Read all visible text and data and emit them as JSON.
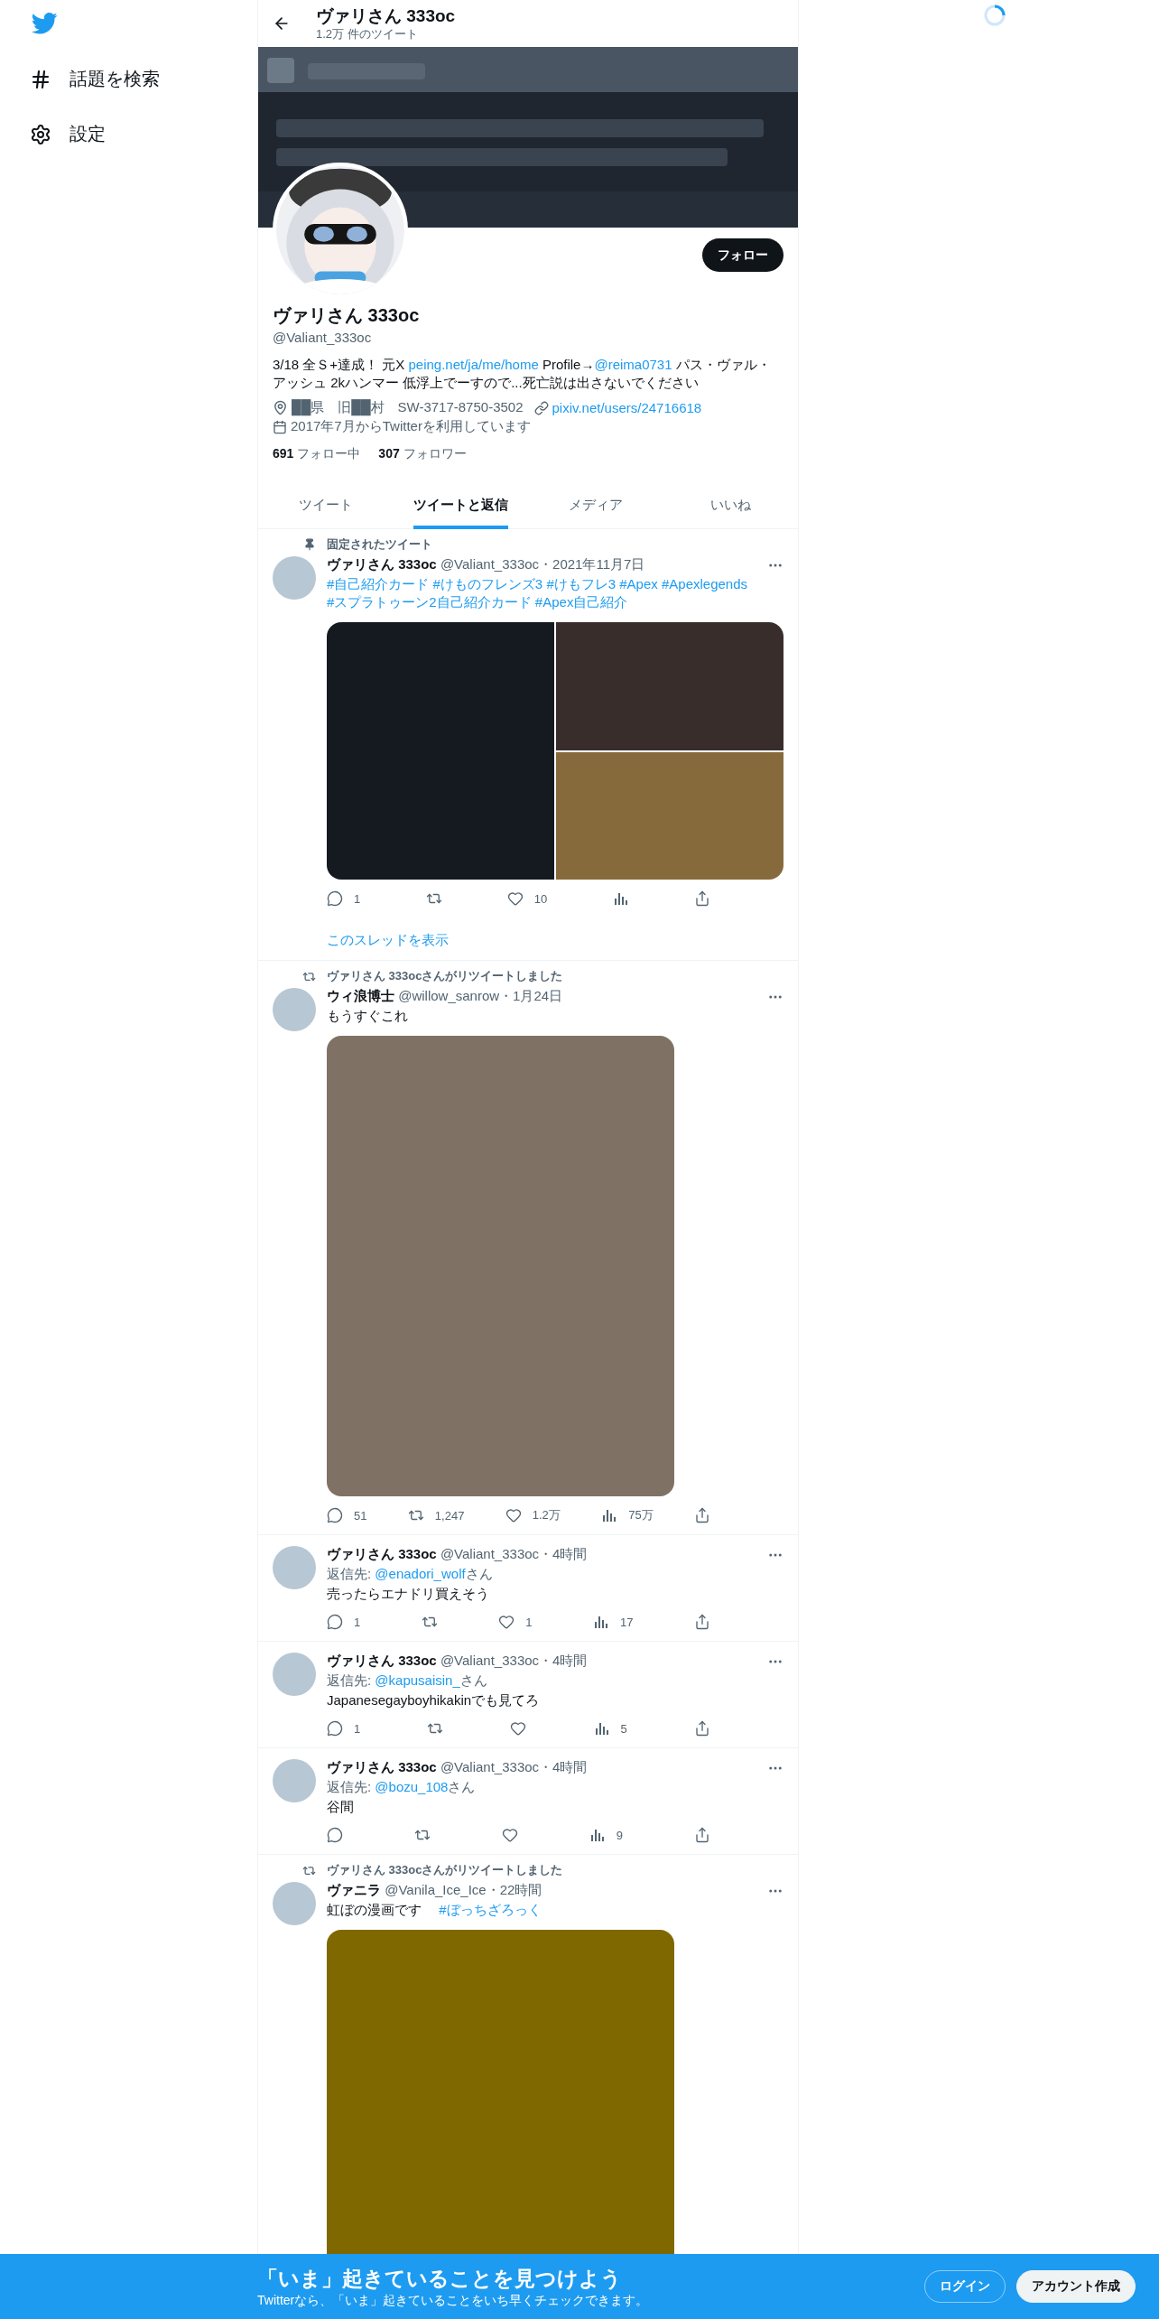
{
  "sidebar": {
    "items": [
      {
        "kind": "explore",
        "label": "話題を検索"
      },
      {
        "kind": "settings",
        "label": "設定"
      }
    ]
  },
  "header": {
    "title": "ヴァリさん 333oc",
    "subtitle": "1.2万 件のツイート"
  },
  "profile": {
    "follow_button": "フォロー",
    "name": "ヴァリさん 333oc",
    "handle": "@Valiant_333oc",
    "bio": [
      {
        "text": "3/18 全Ｓ+達成！ 元X "
      },
      {
        "text": "peing.net/ja/me/home",
        "link": true
      },
      {
        "text": " Profile→"
      },
      {
        "text": "@reima0731",
        "link": true
      },
      {
        "text": " パス・ヴァル・アッシュ 2kハンマー 低浮上でーすので...死亡説は出さないでください"
      }
    ],
    "location": "██県　旧██村　SW-3717-8750-3502",
    "website": "pixiv.net/users/24716618",
    "joined": "2017年7月からTwitterを利用しています",
    "following_count": "691",
    "following_label": "フォロー中",
    "followers_count": "307",
    "followers_label": "フォロワー"
  },
  "tabs": [
    {
      "label": "ツイート",
      "selected": false
    },
    {
      "label": "ツイートと返信",
      "selected": true
    },
    {
      "label": "メディア",
      "selected": false
    },
    {
      "label": "いいね",
      "selected": false
    }
  ],
  "tweets": [
    {
      "context": {
        "kind": "pinned",
        "text": "固定されたツイート"
      },
      "name": "ヴァリさん 333oc",
      "handle": "@Valiant_333oc",
      "time": "・2021年11月7日",
      "text": [
        {
          "text": "#自己紹介カード",
          "link": true
        },
        {
          "text": "#けものフレンズ3",
          "link": true
        },
        {
          "text": "#けもフレ3",
          "link": true
        },
        {
          "text": "#Apex",
          "link": true
        },
        {
          "text": "#Apexlegends",
          "link": true
        },
        {
          "text": "#スプラトゥーン2自己紹介カード",
          "link": true
        },
        {
          "text": "#Apex自己紹介",
          "link": true
        }
      ],
      "media": {
        "kind": "grid",
        "tiles": [
          {
            "color": "#141a20"
          },
          {
            "color": "#382d2b"
          },
          {
            "color": "#876a3c"
          }
        ]
      },
      "actions": [
        {
          "kind": "reply",
          "count": "1"
        },
        {
          "kind": "retweet"
        },
        {
          "kind": "like",
          "count": "10"
        },
        {
          "kind": "views"
        },
        {
          "kind": "share"
        }
      ],
      "show_thread": "このスレッドを表示"
    },
    {
      "context": {
        "kind": "retweet",
        "text": "ヴァリさん 333ocさんがリツイートしました"
      },
      "name": "ウィ浪博士",
      "handle": "@willow_sanrow",
      "time": "・1月24日",
      "text": [
        {
          "text": "もうすぐこれ"
        }
      ],
      "media": {
        "kind": "single",
        "tiles": [
          {
            "color": "#7f7265"
          }
        ]
      },
      "actions": [
        {
          "kind": "reply",
          "count": "51"
        },
        {
          "kind": "retweet",
          "count": "1,247"
        },
        {
          "kind": "like",
          "count": "1.2万"
        },
        {
          "kind": "views",
          "count": "75万"
        },
        {
          "kind": "share"
        }
      ]
    },
    {
      "name": "ヴァリさん 333oc",
      "handle": "@Valiant_333oc",
      "time": "・4時間",
      "reply_to": [
        {
          "text": "返信先: "
        },
        {
          "text": "@enadori_wolf",
          "link": true
        },
        {
          "text": "さん"
        }
      ],
      "text": [
        {
          "text": "売ったらエナドリ買えそう"
        }
      ],
      "actions": [
        {
          "kind": "reply",
          "count": "1"
        },
        {
          "kind": "retweet"
        },
        {
          "kind": "like",
          "count": "1"
        },
        {
          "kind": "views",
          "count": "17"
        },
        {
          "kind": "share"
        }
      ]
    },
    {
      "name": "ヴァリさん 333oc",
      "handle": "@Valiant_333oc",
      "time": "・4時間",
      "reply_to": [
        {
          "text": "返信先: "
        },
        {
          "text": "@kapusaisin_",
          "link": true
        },
        {
          "text": "さん"
        }
      ],
      "text": [
        {
          "text": "Japanesegayboyhikakinでも見てろ"
        }
      ],
      "actions": [
        {
          "kind": "reply",
          "count": "1"
        },
        {
          "kind": "retweet"
        },
        {
          "kind": "like"
        },
        {
          "kind": "views",
          "count": "5"
        },
        {
          "kind": "share"
        }
      ]
    },
    {
      "name": "ヴァリさん 333oc",
      "handle": "@Valiant_333oc",
      "time": "・4時間",
      "reply_to": [
        {
          "text": "返信先: "
        },
        {
          "text": "@bozu_108",
          "link": true
        },
        {
          "text": "さん"
        }
      ],
      "text": [
        {
          "text": "谷間"
        }
      ],
      "actions": [
        {
          "kind": "reply"
        },
        {
          "kind": "retweet"
        },
        {
          "kind": "like"
        },
        {
          "kind": "views",
          "count": "9"
        },
        {
          "kind": "share"
        }
      ]
    },
    {
      "context": {
        "kind": "retweet",
        "text": "ヴァリさん 333ocさんがリツイートしました"
      },
      "name": "ヴァニラ",
      "handle": "@Vanila_Ice_Ice",
      "time": "・22時間",
      "text": [
        {
          "text": "虹ぼの漫画です　 "
        },
        {
          "text": "#ぼっちざろっく",
          "link": true
        }
      ],
      "media": {
        "kind": "single",
        "tiles": [
          {
            "color": "#7f6800"
          }
        ]
      }
    }
  ],
  "bottom_bar": {
    "title": "「いま」起きていることを見つけよう",
    "subtitle": "Twitterなら、「いま」起きていることをいち早くチェックできます。",
    "login": "ログイン",
    "signup": "アカウント作成"
  }
}
